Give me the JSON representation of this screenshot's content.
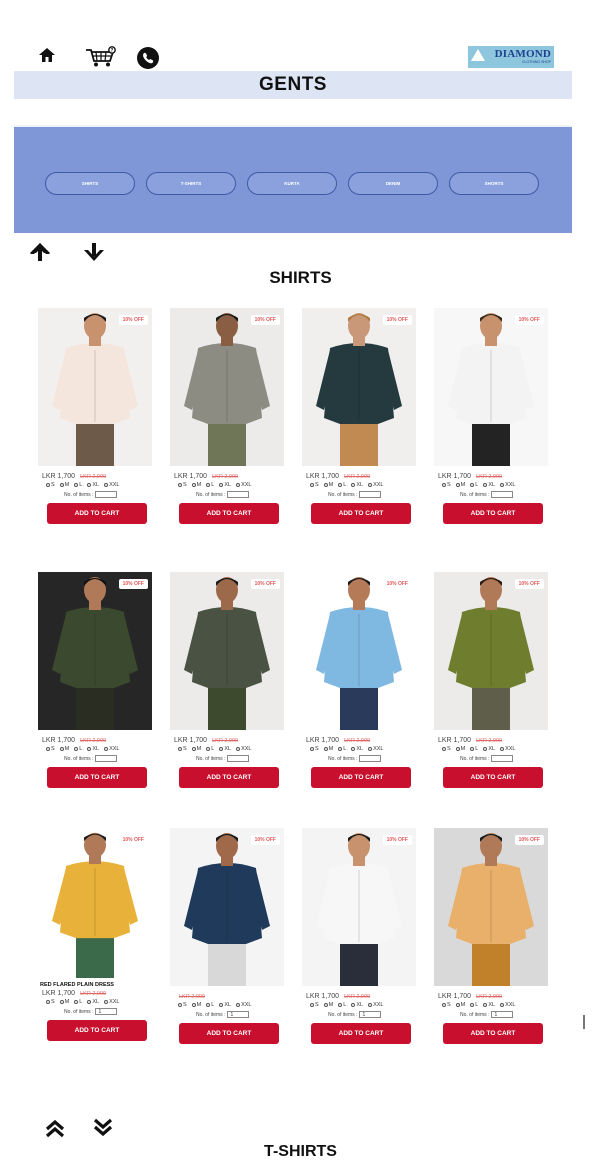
{
  "header": {
    "icons": [
      "home-icon",
      "cart-icon",
      "phone-icon"
    ],
    "logo": {
      "line1": "DIAMOND",
      "line2": "CLOTHING SHOP"
    },
    "section_bar_title": "GENTS"
  },
  "categories": [
    "SHIRTS",
    "T-SHIRTS",
    "KURTA",
    "DENIM",
    "SHORTS"
  ],
  "nav_arrows": [
    "up-arrow-icon",
    "down-arrow-icon"
  ],
  "shirts_section": {
    "title": "SHIRTS",
    "products": [
      {
        "discount": "10% OFF",
        "name": "",
        "price": "LKR 1,700",
        "old_price": "LKR 2,000",
        "qty": "",
        "colors": {
          "bg": "#f2f0ee",
          "shirt": "#f4e6dc",
          "pants": "#6e5a48",
          "skin": "#c8926e",
          "hair": "#1a1a1a"
        }
      },
      {
        "discount": "10% OFF",
        "name": "",
        "price": "LKR 1,700",
        "old_price": "LKR 2,000",
        "qty": "",
        "colors": {
          "bg": "#ecebea",
          "shirt": "#8c8c82",
          "pants": "#6f7658",
          "skin": "#8a5e42",
          "hair": "#1a1a1a"
        }
      },
      {
        "discount": "10% OFF",
        "name": "",
        "price": "LKR 1,700",
        "old_price": "LKR 2,000",
        "qty": "",
        "colors": {
          "bg": "#f0efee",
          "shirt": "#243a3e",
          "pants": "#c08a52",
          "skin": "#c99878",
          "hair": "#b07a3c"
        }
      },
      {
        "discount": "10% OFF",
        "name": "",
        "price": "LKR 1,700",
        "old_price": "LKR 2,000",
        "qty": "",
        "colors": {
          "bg": "#f7f7f7",
          "shirt": "#f3f3f3",
          "pants": "#232323",
          "skin": "#c8926e",
          "hair": "#3a2a1c"
        }
      },
      {
        "discount": "10% OFF",
        "name": "",
        "price": "LKR 1,700",
        "old_price": "LKR 2,000",
        "qty": "",
        "colors": {
          "bg": "#262626",
          "shirt": "#3b4a2e",
          "pants": "#2a2e22",
          "skin": "#b07a58",
          "hair": "#111111"
        }
      },
      {
        "discount": "10% OFF",
        "name": "",
        "price": "LKR 1,700",
        "old_price": "LKR 2,000",
        "qty": "",
        "colors": {
          "bg": "#ecebea",
          "shirt": "#4a5244",
          "pants": "#3e4a2e",
          "skin": "#9c6a4a",
          "hair": "#1a1a1a"
        }
      },
      {
        "discount": "10% OFF",
        "name": "",
        "price": "LKR 1,700",
        "old_price": "LKR 2,000",
        "qty": "",
        "colors": {
          "bg": "#ffffff",
          "shirt": "#7fb8e0",
          "pants": "#2a3a5a",
          "skin": "#b57a58",
          "hair": "#1a1a1a"
        }
      },
      {
        "discount": "10% OFF",
        "name": "",
        "price": "LKR 1,700",
        "old_price": "LKR 2,000",
        "qty": "",
        "colors": {
          "bg": "#ecebea",
          "shirt": "#6e7e2e",
          "pants": "#5e5e4a",
          "skin": "#b07a58",
          "hair": "#2a1a10"
        }
      },
      {
        "discount": "10% OFF",
        "name": "RED FLARED PLAIN DRESS",
        "price": "LKR 1,700",
        "old_price": "LKR 2,000",
        "qty": "1",
        "colors": {
          "bg": "#ffffff",
          "shirt": "#e8b23a",
          "pants": "#3a6a4a",
          "skin": "#b07a58",
          "hair": "#1a1a1a"
        }
      },
      {
        "discount": "10% OFF",
        "name": "",
        "price": "",
        "old_price": "LKR 2,000",
        "qty": "1",
        "colors": {
          "bg": "#f4f4f4",
          "shirt": "#1f3a5a",
          "pants": "#d8d8d8",
          "skin": "#a06a4a",
          "hair": "#1a1a1a"
        }
      },
      {
        "discount": "10% OFF",
        "name": "",
        "price": "LKR 1,700",
        "old_price": "LKR 2,000",
        "qty": "1",
        "colors": {
          "bg": "#f4f4f4",
          "shirt": "#f7f7f7",
          "pants": "#2a2e3a",
          "skin": "#c8926e",
          "hair": "#1a1a1a"
        }
      },
      {
        "discount": "10% OFF",
        "name": "",
        "price": "LKR 1,700",
        "old_price": "LKR 2,000",
        "qty": "1",
        "colors": {
          "bg": "#d9d9d9",
          "shirt": "#e8b06a",
          "pants": "#c0812a",
          "skin": "#b07a58",
          "hair": "#1a1a1a"
        }
      }
    ],
    "size_options": [
      "S",
      "M",
      "L",
      "XL",
      "XXL"
    ],
    "qty_label": "No. of items :",
    "add_to_cart_label": "ADD TO CART"
  },
  "nav_arrows_double": [
    "double-up-arrow-icon",
    "double-down-arrow-icon"
  ],
  "tshirts_section": {
    "title": "T-SHIRTS"
  },
  "theme": {
    "category_panel": "#7f97d6",
    "section_bar": "#dde5f4",
    "cta": "#c8102e",
    "discount_text": "#e05a5a"
  }
}
